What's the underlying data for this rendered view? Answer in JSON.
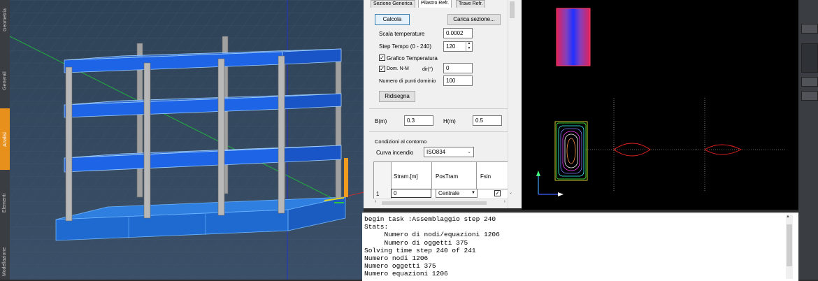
{
  "sidebar": {
    "tabs": [
      {
        "label": "Geometria",
        "active": false
      },
      {
        "label": "Generali",
        "active": false
      },
      {
        "label": "Analisi",
        "active": true
      },
      {
        "label": "Elementi",
        "active": false
      },
      {
        "label": "Modellazione",
        "active": false
      }
    ]
  },
  "panel": {
    "tabs": [
      "Sezione Generica",
      "Pilastro Refr.",
      "Trave Refr."
    ],
    "active_tab": "Pilastro Refr.",
    "calcola_label": "Calcola",
    "carica_label": "Carica sezione...",
    "scala_label": "Scala temperature",
    "scala_value": "0.0002",
    "step_label": "Step Tempo (0 - 240)",
    "step_value": "120",
    "grafico_label": "Grafico Temperatura",
    "grafico_checked": true,
    "dom_label": "Dom. N-M",
    "dom_checked": true,
    "dir_label": "dir(°)",
    "dir_value": "0",
    "punti_label": "Numero di punti dominio",
    "punti_value": "100",
    "ridisegna_label": "Ridisegna",
    "b_label": "B(m)",
    "b_value": "0.3",
    "h_label": "H(m)",
    "h_value": "0.5",
    "condizioni_label": "Condizioni al contorno",
    "curva_label": "Curva incendio",
    "curva_value": "ISO834",
    "table": {
      "headers": [
        "Stram.[m]",
        "PosTram",
        "Fsin"
      ],
      "rows": [
        {
          "index": "1",
          "stram": "0",
          "postram": "Centrale",
          "fsin": true
        }
      ]
    }
  },
  "console": {
    "lines": [
      "begin task :Assemblaggio step 240",
      "Stats:",
      "     Numero di nodi/equazioni 1206",
      "     Numero di oggetti 375",
      "Solving time step 240 of 241",
      "Numero nodi 1206",
      "Numero oggetti 375",
      "Numero equazioni 1206"
    ]
  },
  "colors": {
    "slab": "#1e64e6",
    "column": "#a9a9a9",
    "accent_tab": "#e8901c",
    "viewport_bg": "#34485f"
  }
}
